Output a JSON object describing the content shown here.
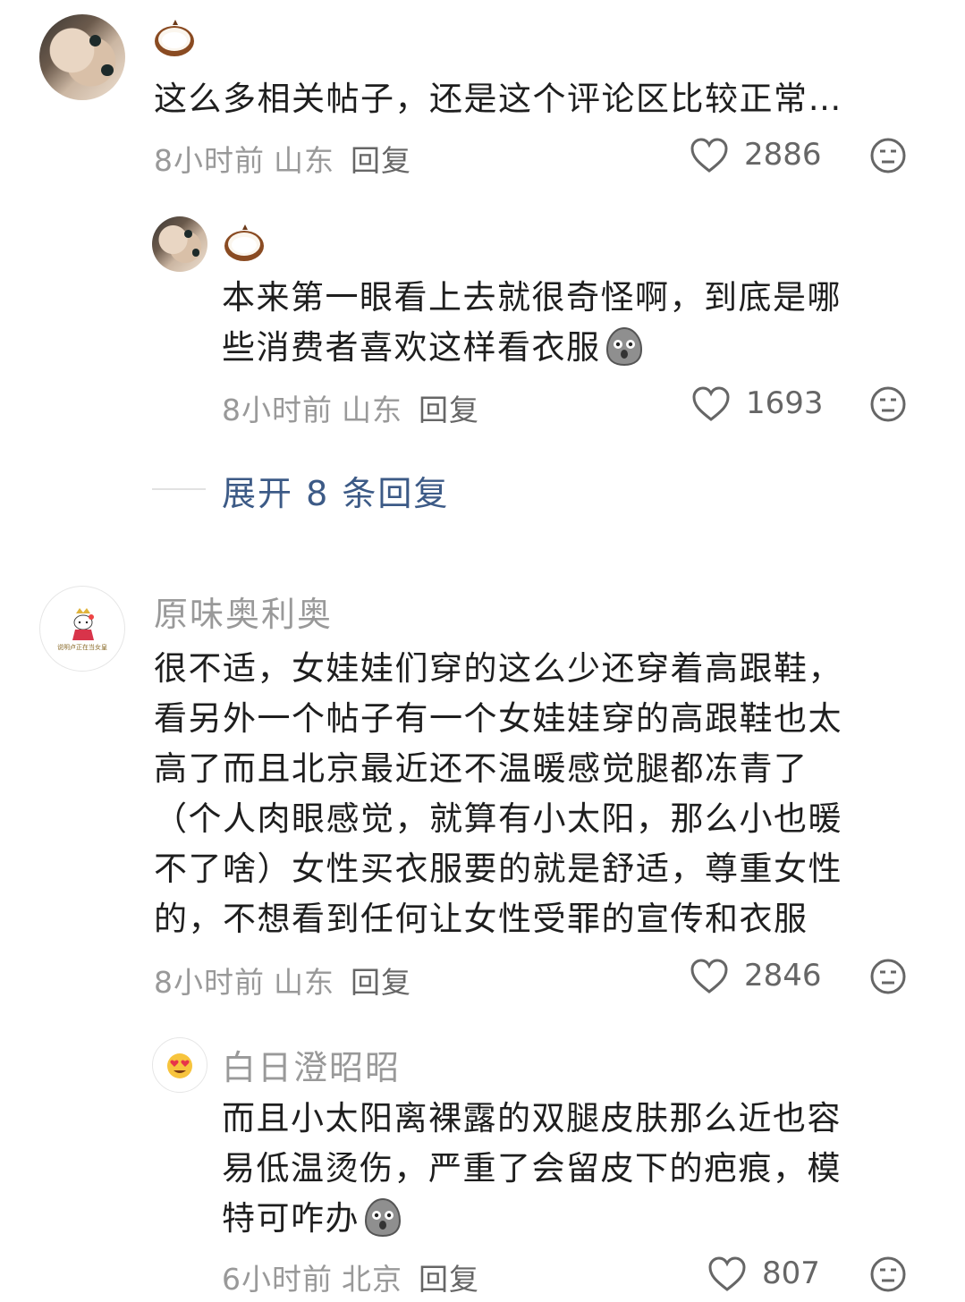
{
  "comments": [
    {
      "username_emoji": "coconut",
      "text": "这么多相关帖子，还是这个评论区比较正常…",
      "time": "8小时前",
      "location": "山东",
      "reply_label": "回复",
      "likes": "2886",
      "reply": {
        "username_emoji": "coconut",
        "text_line1": "本来第一眼看上去就很奇怪啊，到底是哪",
        "text_line2": "些消费者喜欢这样看衣服",
        "time": "8小时前",
        "location": "山东",
        "reply_label": "回复",
        "likes": "1693"
      },
      "expand_label": "展开 8 条回复"
    },
    {
      "username": "原味奥利奥",
      "avatar_caption": "说明卢正在当女皇",
      "lines": [
        "很不适，女娃娃们穿的这么少还穿着高跟鞋，",
        "看另外一个帖子有一个女娃娃穿的高跟鞋也太",
        "高了而且北京最近还不温暖感觉腿都冻青了",
        "（个人肉眼感觉，就算有小太阳，那么小也暖",
        "不了啥）女性买衣服要的就是舒适，尊重女性",
        "的，不想看到任何让女性受罪的宣传和衣服"
      ],
      "time": "8小时前",
      "location": "山东",
      "reply_label": "回复",
      "likes": "2846",
      "reply": {
        "username": "白日澄昭昭",
        "lines": [
          "而且小太阳离裸露的双腿皮肤那么近也容",
          "易低温烫伤，严重了会留皮下的疤痕，模",
          "特可咋办"
        ],
        "time": "6小时前",
        "location": "北京",
        "reply_label": "回复",
        "likes": "807"
      }
    }
  ],
  "colors": {
    "meta": "#999999",
    "text": "#1e1e1e",
    "link": "#3c5a86"
  }
}
